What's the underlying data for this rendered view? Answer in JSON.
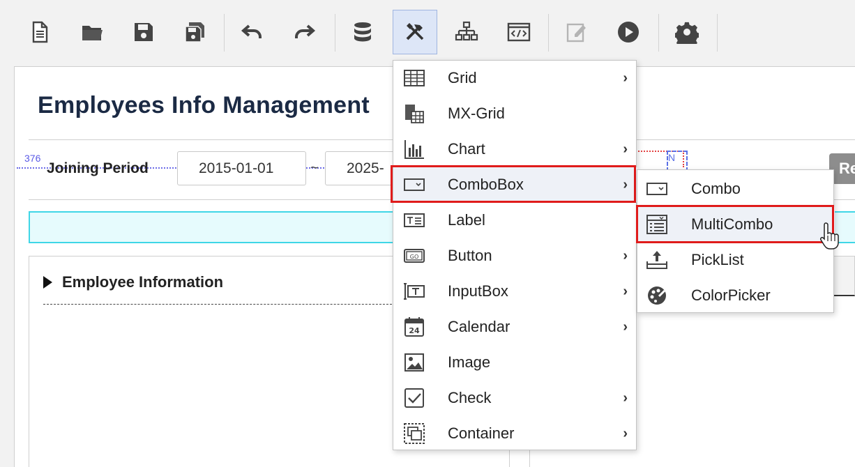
{
  "toolbar": {
    "buttons": [
      {
        "name": "new-file-icon"
      },
      {
        "name": "open-folder-icon"
      },
      {
        "name": "save-icon"
      },
      {
        "name": "save-all-icon"
      },
      {
        "name": "undo-icon"
      },
      {
        "name": "redo-icon"
      },
      {
        "name": "database-icon"
      },
      {
        "name": "tools-icon"
      },
      {
        "name": "hierarchy-icon"
      },
      {
        "name": "code-icon"
      },
      {
        "name": "edit-icon"
      },
      {
        "name": "play-icon"
      },
      {
        "name": "gear-icon"
      }
    ]
  },
  "canvas": {
    "page_title": "Employees Info Management",
    "guide_number": "376",
    "joining_label": "Joining Period",
    "date_from": "2015-01-01",
    "date_to": "2025-",
    "tilde": "~",
    "guide_marker": "N",
    "right_button_label": "Re",
    "panel_title": "Employee Information"
  },
  "menu": {
    "items": [
      {
        "label": "Grid",
        "icon": "grid-icon",
        "submenu": true
      },
      {
        "label": "MX-Grid",
        "icon": "mx-grid-icon",
        "submenu": false
      },
      {
        "label": "Chart",
        "icon": "chart-icon",
        "submenu": true
      },
      {
        "label": "ComboBox",
        "icon": "combobox-icon",
        "submenu": true
      },
      {
        "label": "Label",
        "icon": "label-icon",
        "submenu": false
      },
      {
        "label": "Button",
        "icon": "button-icon",
        "submenu": true
      },
      {
        "label": "InputBox",
        "icon": "inputbox-icon",
        "submenu": true
      },
      {
        "label": "Calendar",
        "icon": "calendar-icon",
        "submenu": true
      },
      {
        "label": "Image",
        "icon": "image-icon",
        "submenu": false
      },
      {
        "label": "Check",
        "icon": "check-icon",
        "submenu": true
      },
      {
        "label": "Container",
        "icon": "container-icon",
        "submenu": true
      }
    ],
    "arrow": "›"
  },
  "submenu": {
    "items": [
      {
        "label": "Combo",
        "icon": "combo-icon"
      },
      {
        "label": "MultiCombo",
        "icon": "multicombo-icon"
      },
      {
        "label": "PickList",
        "icon": "picklist-icon"
      },
      {
        "label": "ColorPicker",
        "icon": "colorpicker-icon"
      }
    ]
  },
  "colors": {
    "highlight_border": "#e01b1b",
    "title": "#1b2a44",
    "cyan_border": "#3fd6e6",
    "active_toolbar": "#dde6f7"
  }
}
